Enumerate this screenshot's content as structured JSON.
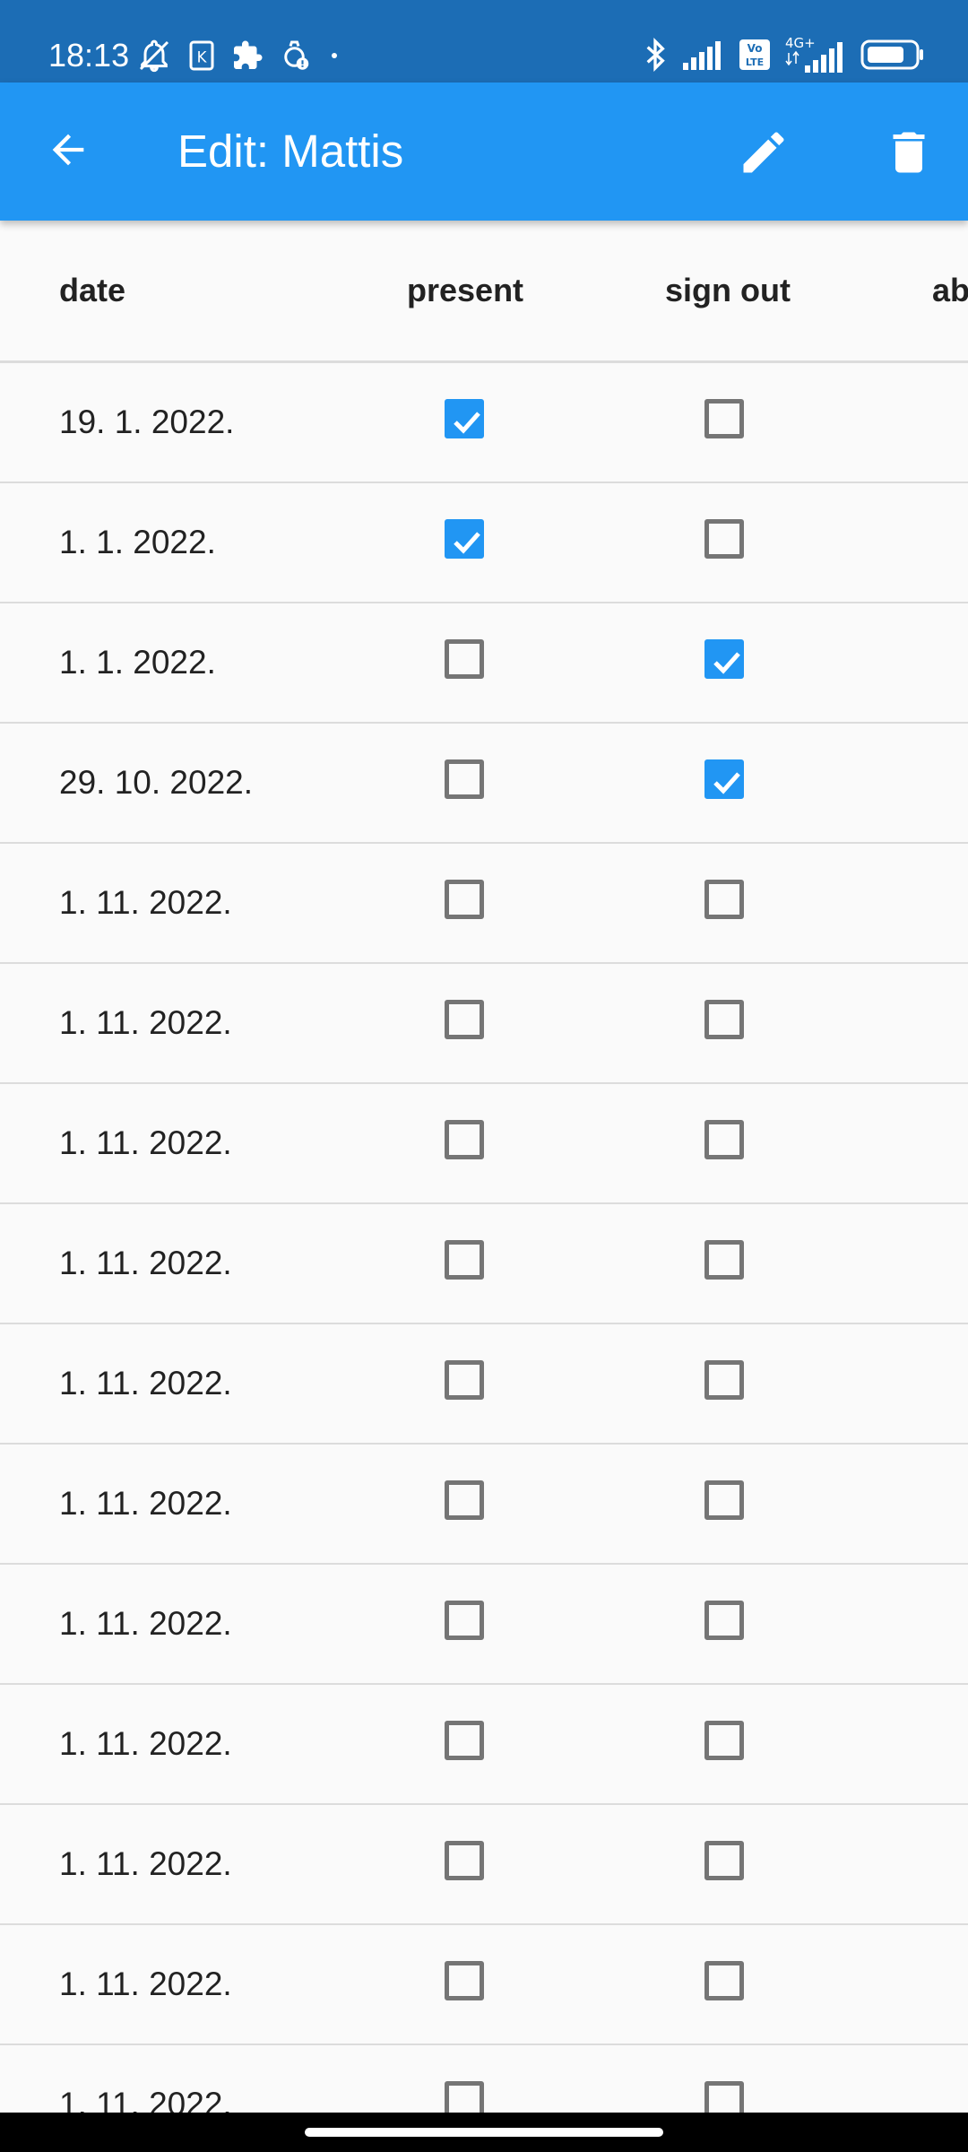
{
  "status_bar": {
    "time": "18:13",
    "icons_left": [
      "bell-off-icon",
      "k-app-icon",
      "puzzle-icon",
      "watch-alert-icon",
      "dot-icon"
    ],
    "icons_right": [
      "bluetooth-icon",
      "signal-icon",
      "volte-icon",
      "4g-signal-icon",
      "battery-icon"
    ],
    "network_label": "4G+",
    "volte_label": "Vo LTE"
  },
  "app_bar": {
    "title": "Edit: Mattis",
    "color": "#2196f3"
  },
  "table": {
    "columns": [
      "date",
      "present",
      "sign out",
      "ab"
    ],
    "rows": [
      {
        "date": "19. 1. 2022.",
        "present": true,
        "sign_out": false
      },
      {
        "date": "1. 1. 2022.",
        "present": true,
        "sign_out": false
      },
      {
        "date": "1. 1. 2022.",
        "present": false,
        "sign_out": true
      },
      {
        "date": "29. 10. 2022.",
        "present": false,
        "sign_out": true
      },
      {
        "date": "1. 11. 2022.",
        "present": false,
        "sign_out": false
      },
      {
        "date": "1. 11. 2022.",
        "present": false,
        "sign_out": false
      },
      {
        "date": "1. 11. 2022.",
        "present": false,
        "sign_out": false
      },
      {
        "date": "1. 11. 2022.",
        "present": false,
        "sign_out": false
      },
      {
        "date": "1. 11. 2022.",
        "present": false,
        "sign_out": false
      },
      {
        "date": "1. 11. 2022.",
        "present": false,
        "sign_out": false
      },
      {
        "date": "1. 11. 2022.",
        "present": false,
        "sign_out": false
      },
      {
        "date": "1. 11. 2022.",
        "present": false,
        "sign_out": false
      },
      {
        "date": "1. 11. 2022.",
        "present": false,
        "sign_out": false
      },
      {
        "date": "1. 11. 2022.",
        "present": false,
        "sign_out": false
      },
      {
        "date": "1. 11. 2022.",
        "present": false,
        "sign_out": false
      }
    ]
  },
  "colors": {
    "status_bar": "#1c6db5",
    "accent": "#2196f3",
    "unchecked_border": "#757575"
  }
}
